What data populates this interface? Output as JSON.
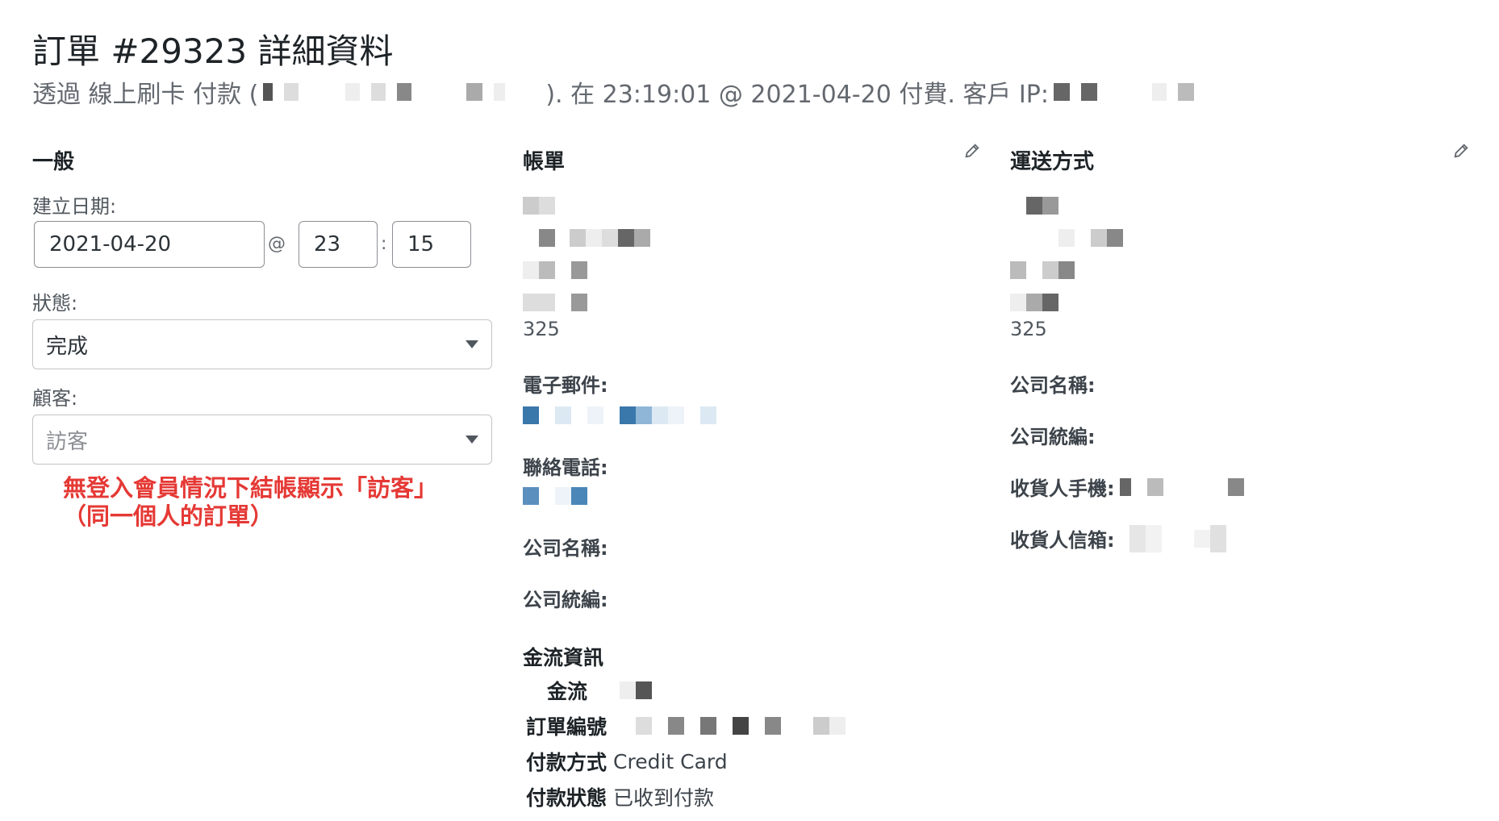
{
  "header": {
    "title": "訂單 #29323 詳細資料",
    "sub_prefix": "透過 線上刷卡 付款 (",
    "sub_middle": "). 在 23:19:01 @ 2021-04-20 付費. 客戶 IP:"
  },
  "general": {
    "heading": "一般",
    "created_label": "建立日期:",
    "date_value": "2021-04-20",
    "at_symbol": "@",
    "hour_value": "23",
    "colon": ":",
    "minute_value": "15",
    "status_label": "狀態:",
    "status_value": "完成",
    "customer_label": "顧客:",
    "customer_value": "訪客",
    "annotation_line1": "無登入會員情況下結帳顯示「訪客」",
    "annotation_line2": "（同一個人的訂單）"
  },
  "billing": {
    "heading": "帳單",
    "postcode": "325",
    "email_label": "電子郵件:",
    "phone_label": "聯絡電話:",
    "company_label": "公司名稱:",
    "tax_label": "公司統編:"
  },
  "payment_info": {
    "heading": "金流資訊",
    "gateway_label": "金流",
    "order_no_label": "訂單編號",
    "method_label": "付款方式",
    "method_value": "Credit Card",
    "status_label": "付款狀態",
    "status_value": "已收到付款"
  },
  "shipping": {
    "heading": "運送方式",
    "postcode": "325",
    "company_label": "公司名稱:",
    "tax_label": "公司統編:",
    "mobile_label": "收貨人手機:",
    "email_label": "收貨人信箱:"
  },
  "icons": {
    "edit": "pencil-icon",
    "dropdown": "caret-down-icon"
  },
  "colors": {
    "annotation": "#e53935",
    "redaction_gray": "#8a8a8a",
    "redaction_blue": "#3a77ab"
  }
}
